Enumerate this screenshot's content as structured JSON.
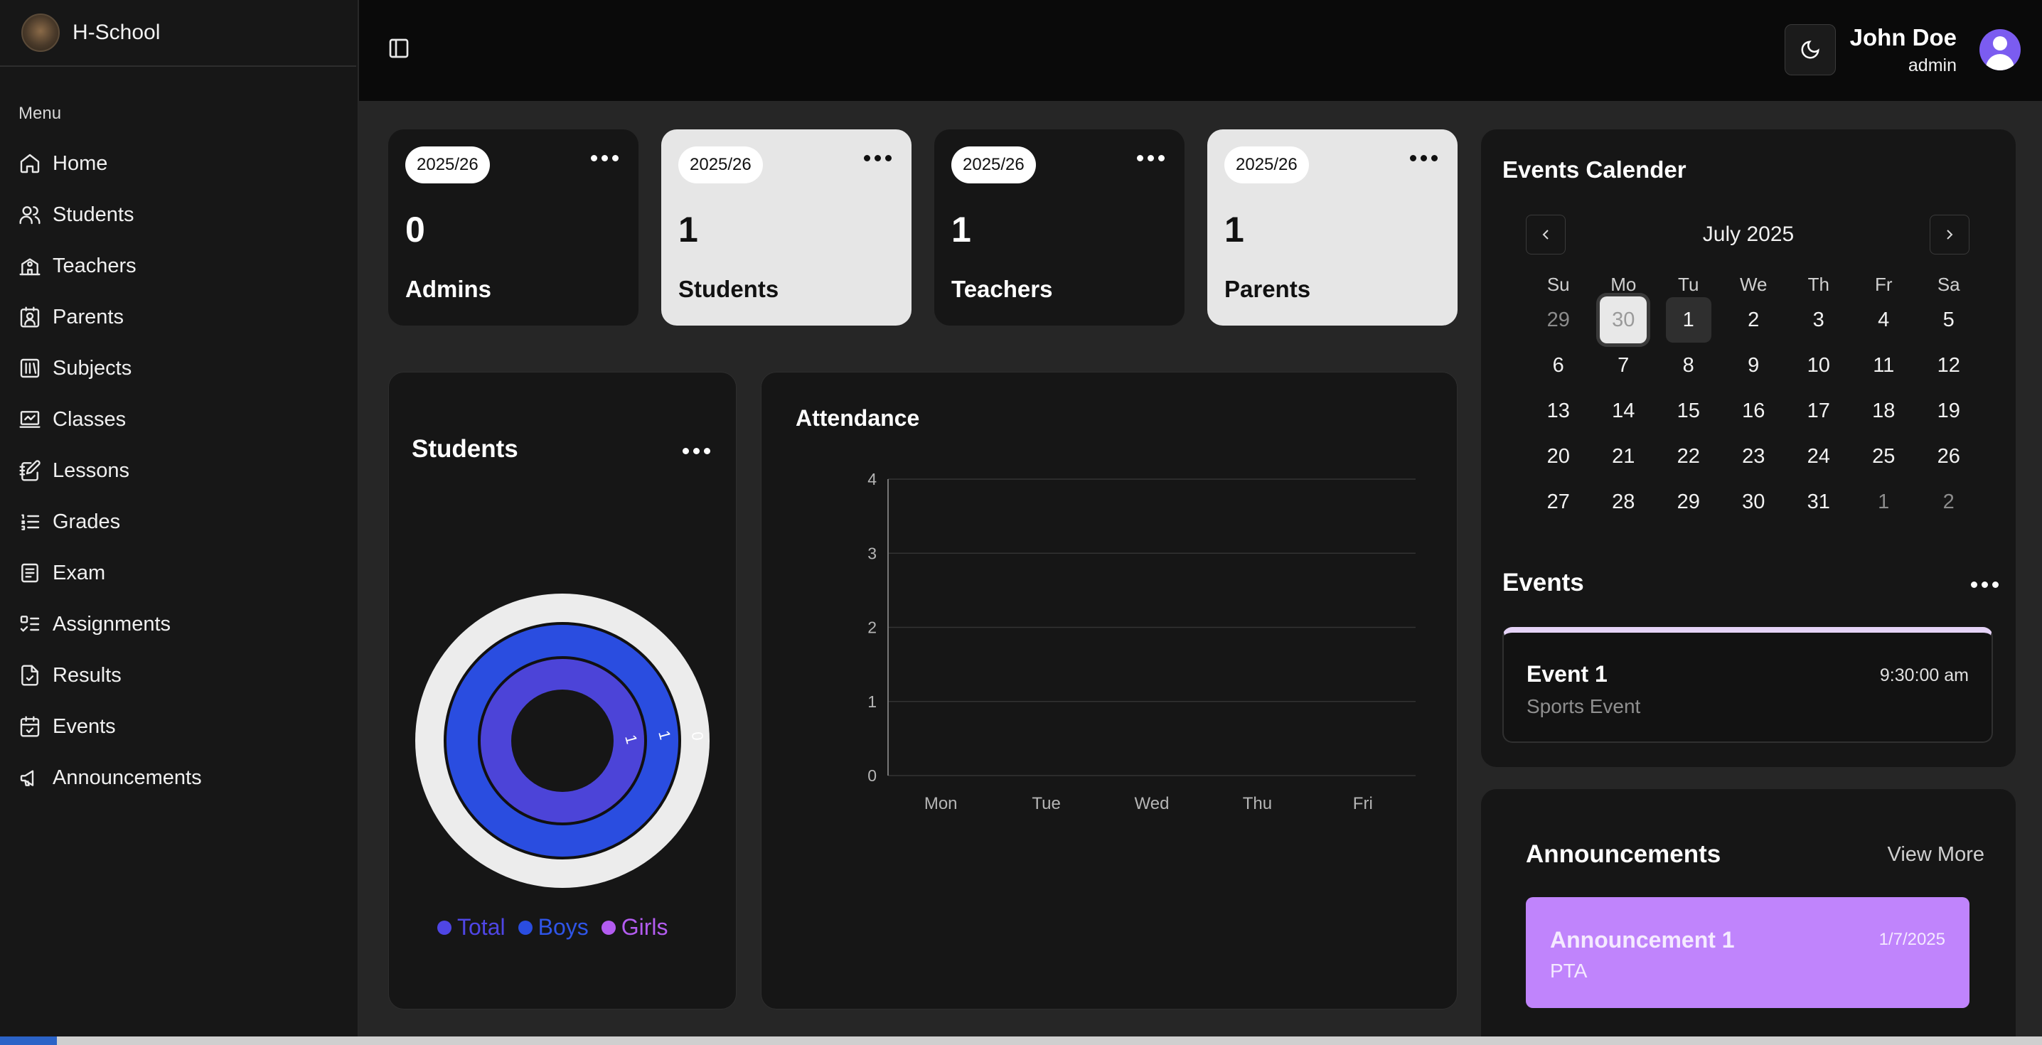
{
  "brand": {
    "name": "H-School"
  },
  "sidebar": {
    "menu_title": "Menu",
    "items": [
      {
        "label": "Home",
        "icon": "home-icon"
      },
      {
        "label": "Students",
        "icon": "users-icon"
      },
      {
        "label": "Teachers",
        "icon": "school-icon"
      },
      {
        "label": "Parents",
        "icon": "contact-icon"
      },
      {
        "label": "Subjects",
        "icon": "library-icon"
      },
      {
        "label": "Classes",
        "icon": "presentation-icon"
      },
      {
        "label": "Lessons",
        "icon": "notebook-pen-icon"
      },
      {
        "label": "Grades",
        "icon": "list-ordered-icon"
      },
      {
        "label": "Exam",
        "icon": "file-text-icon"
      },
      {
        "label": "Assignments",
        "icon": "list-todo-icon"
      },
      {
        "label": "Results",
        "icon": "file-check-icon"
      },
      {
        "label": "Events",
        "icon": "calendar-check-icon"
      },
      {
        "label": "Announcements",
        "icon": "megaphone-icon"
      }
    ]
  },
  "header": {
    "user_name": "John Doe",
    "user_role": "admin"
  },
  "stats": [
    {
      "year": "2025/26",
      "count": "0",
      "label": "Admins",
      "theme": "dark"
    },
    {
      "year": "2025/26",
      "count": "1",
      "label": "Students",
      "theme": "light"
    },
    {
      "year": "2025/26",
      "count": "1",
      "label": "Teachers",
      "theme": "dark"
    },
    {
      "year": "2025/26",
      "count": "1",
      "label": "Parents",
      "theme": "light"
    }
  ],
  "students_chart": {
    "title": "Students",
    "legend": [
      {
        "label": "Total",
        "color": "#4f46e5"
      },
      {
        "label": "Boys",
        "color": "#2a4de0"
      },
      {
        "label": "Girls",
        "color": "#b35cf0"
      }
    ],
    "ring_labels": [
      "1",
      "1",
      "0"
    ]
  },
  "chart_data": {
    "type": "bar",
    "title": "Attendance",
    "categories": [
      "Mon",
      "Tue",
      "Wed",
      "Thu",
      "Fri"
    ],
    "series": [],
    "ylim": [
      0,
      4
    ],
    "yticks": [
      "0",
      "1",
      "2",
      "3",
      "4"
    ],
    "grid": true
  },
  "calendar": {
    "title": "Events Calender",
    "month": "July 2025",
    "weekdays": [
      "Su",
      "Mo",
      "Tu",
      "We",
      "Th",
      "Fr",
      "Sa"
    ],
    "days": [
      {
        "d": "29",
        "out": true
      },
      {
        "d": "30",
        "out": true,
        "selected": true
      },
      {
        "d": "1",
        "today": true
      },
      {
        "d": "2"
      },
      {
        "d": "3"
      },
      {
        "d": "4"
      },
      {
        "d": "5"
      },
      {
        "d": "6"
      },
      {
        "d": "7"
      },
      {
        "d": "8"
      },
      {
        "d": "9"
      },
      {
        "d": "10"
      },
      {
        "d": "11"
      },
      {
        "d": "12"
      },
      {
        "d": "13"
      },
      {
        "d": "14"
      },
      {
        "d": "15"
      },
      {
        "d": "16"
      },
      {
        "d": "17"
      },
      {
        "d": "18"
      },
      {
        "d": "19"
      },
      {
        "d": "20"
      },
      {
        "d": "21"
      },
      {
        "d": "22"
      },
      {
        "d": "23"
      },
      {
        "d": "24"
      },
      {
        "d": "25"
      },
      {
        "d": "26"
      },
      {
        "d": "27"
      },
      {
        "d": "28"
      },
      {
        "d": "29"
      },
      {
        "d": "30"
      },
      {
        "d": "31"
      },
      {
        "d": "1",
        "out": true
      },
      {
        "d": "2",
        "out": true
      }
    ]
  },
  "events": {
    "title": "Events",
    "items": [
      {
        "name": "Event 1",
        "time": "9:30:00 am",
        "description": "Sports Event"
      }
    ]
  },
  "announcements": {
    "title": "Announcements",
    "view_more": "View More",
    "items": [
      {
        "name": "Announcement 1",
        "date": "1/7/2025",
        "description": "PTA"
      }
    ]
  }
}
